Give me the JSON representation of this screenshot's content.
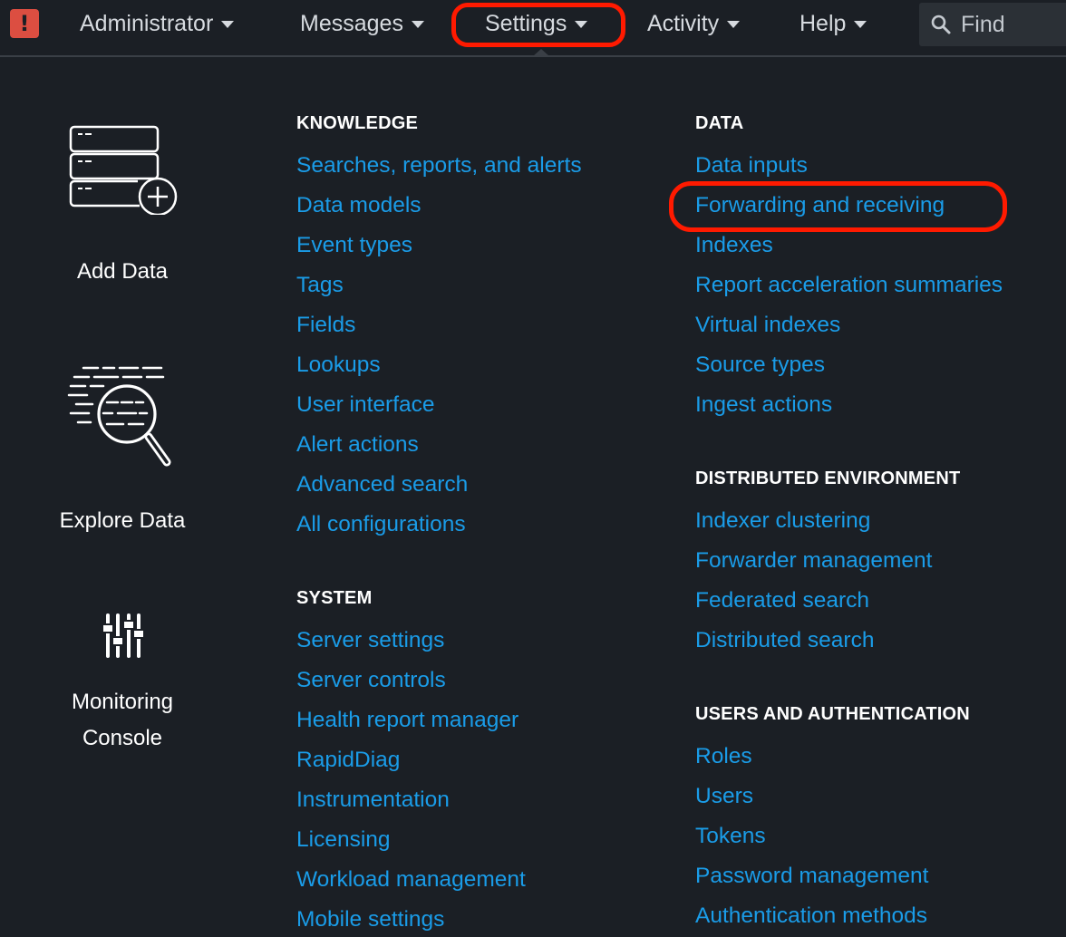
{
  "nav": {
    "alert_badge": "!",
    "items": [
      {
        "label": "Administrator"
      },
      {
        "label": "Messages"
      },
      {
        "label": "Settings"
      },
      {
        "label": "Activity"
      },
      {
        "label": "Help"
      }
    ],
    "find_label": "Find"
  },
  "apps": [
    {
      "label": "Add Data",
      "icon": "add-data-icon"
    },
    {
      "label": "Explore Data",
      "icon": "explore-data-icon"
    },
    {
      "label_line1": "Monitoring",
      "label_line2": "Console",
      "icon": "monitoring-console-icon"
    }
  ],
  "knowledge": {
    "header": "KNOWLEDGE",
    "links": [
      "Searches, reports, and alerts",
      "Data models",
      "Event types",
      "Tags",
      "Fields",
      "Lookups",
      "User interface",
      "Alert actions",
      "Advanced search",
      "All configurations"
    ]
  },
  "system": {
    "header": "SYSTEM",
    "links": [
      "Server settings",
      "Server controls",
      "Health report manager",
      "RapidDiag",
      "Instrumentation",
      "Licensing",
      "Workload management",
      "Mobile settings"
    ]
  },
  "data": {
    "header": "DATA",
    "links": [
      "Data inputs",
      "Forwarding and receiving",
      "Indexes",
      "Report acceleration summaries",
      "Virtual indexes",
      "Source types",
      "Ingest actions"
    ]
  },
  "distributed": {
    "header": "DISTRIBUTED ENVIRONMENT",
    "links": [
      "Indexer clustering",
      "Forwarder management",
      "Federated search",
      "Distributed search"
    ]
  },
  "users_auth": {
    "header": "USERS AND AUTHENTICATION",
    "links": [
      "Roles",
      "Users",
      "Tokens",
      "Password management",
      "Authentication methods"
    ]
  },
  "colors": {
    "background": "#1b1f25",
    "link": "#1a9ce8",
    "highlight": "#ff1a00",
    "alert": "#dc4e41"
  }
}
